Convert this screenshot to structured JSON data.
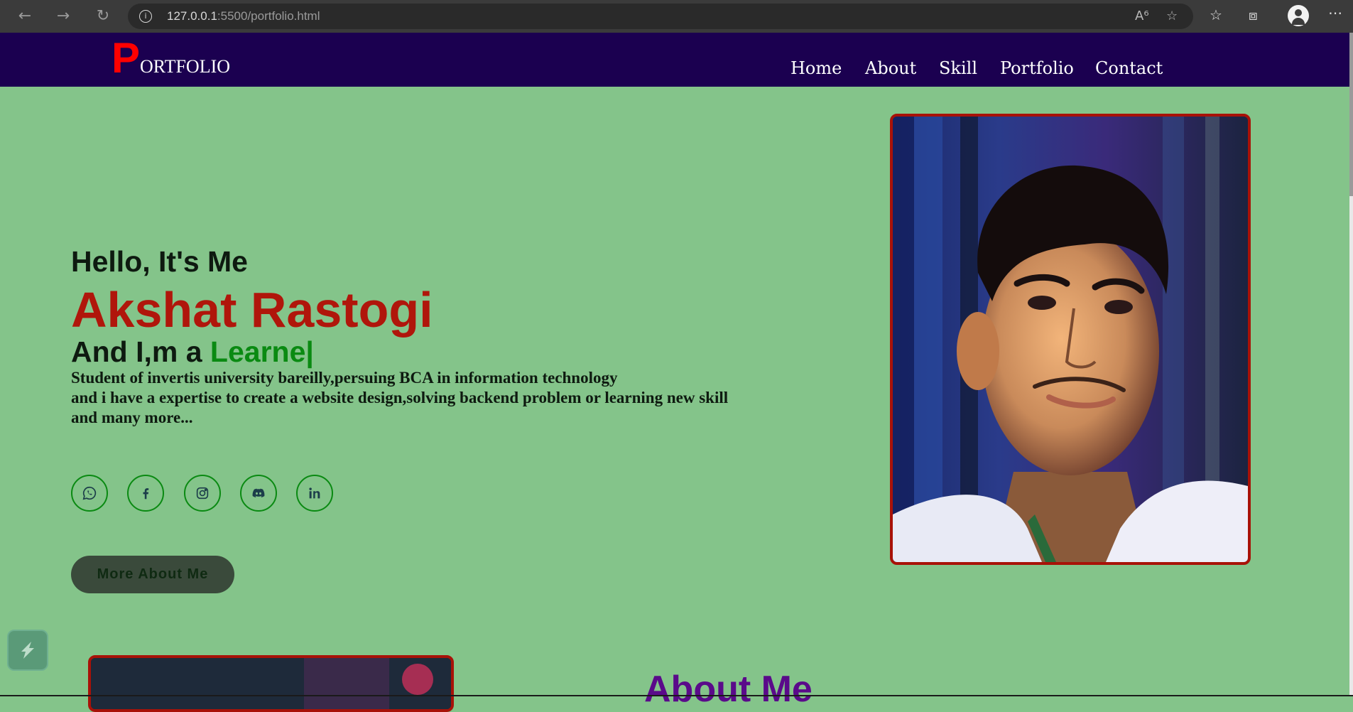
{
  "browser": {
    "url_host": "127.0.0.1",
    "url_rest": ":5500/portfolio.html"
  },
  "header": {
    "logo_first_letter": "P",
    "logo_rest": "ORTFOLIO",
    "nav": [
      "Home",
      "About",
      "Skill",
      "Portfolio",
      "Contact"
    ]
  },
  "hero": {
    "greeting": "Hello, It's Me",
    "name": "Akshat Rastogi",
    "tagline_prefix": "And I,m a ",
    "tagline_typed": "Learne|",
    "bio_lines": [
      "Student of invertis university bareilly,persuing BCA in information technology",
      "and i have a expertise to create a website design,solving backend problem or learning new skill",
      "and many more..."
    ],
    "socials": [
      "whatsapp-icon",
      "facebook-icon",
      "instagram-icon",
      "discord-icon",
      "linkedin-icon"
    ],
    "cta_label": "More About Me"
  },
  "about": {
    "heading": "About Me"
  },
  "colors": {
    "page_bg": "#84c48a",
    "header_bg": "#1b0050",
    "logo_accent": "#ff0000",
    "name": "#b0160b",
    "typed": "#0a8a12",
    "photo_border": "#a81208",
    "about_heading": "#5a0a8a"
  }
}
